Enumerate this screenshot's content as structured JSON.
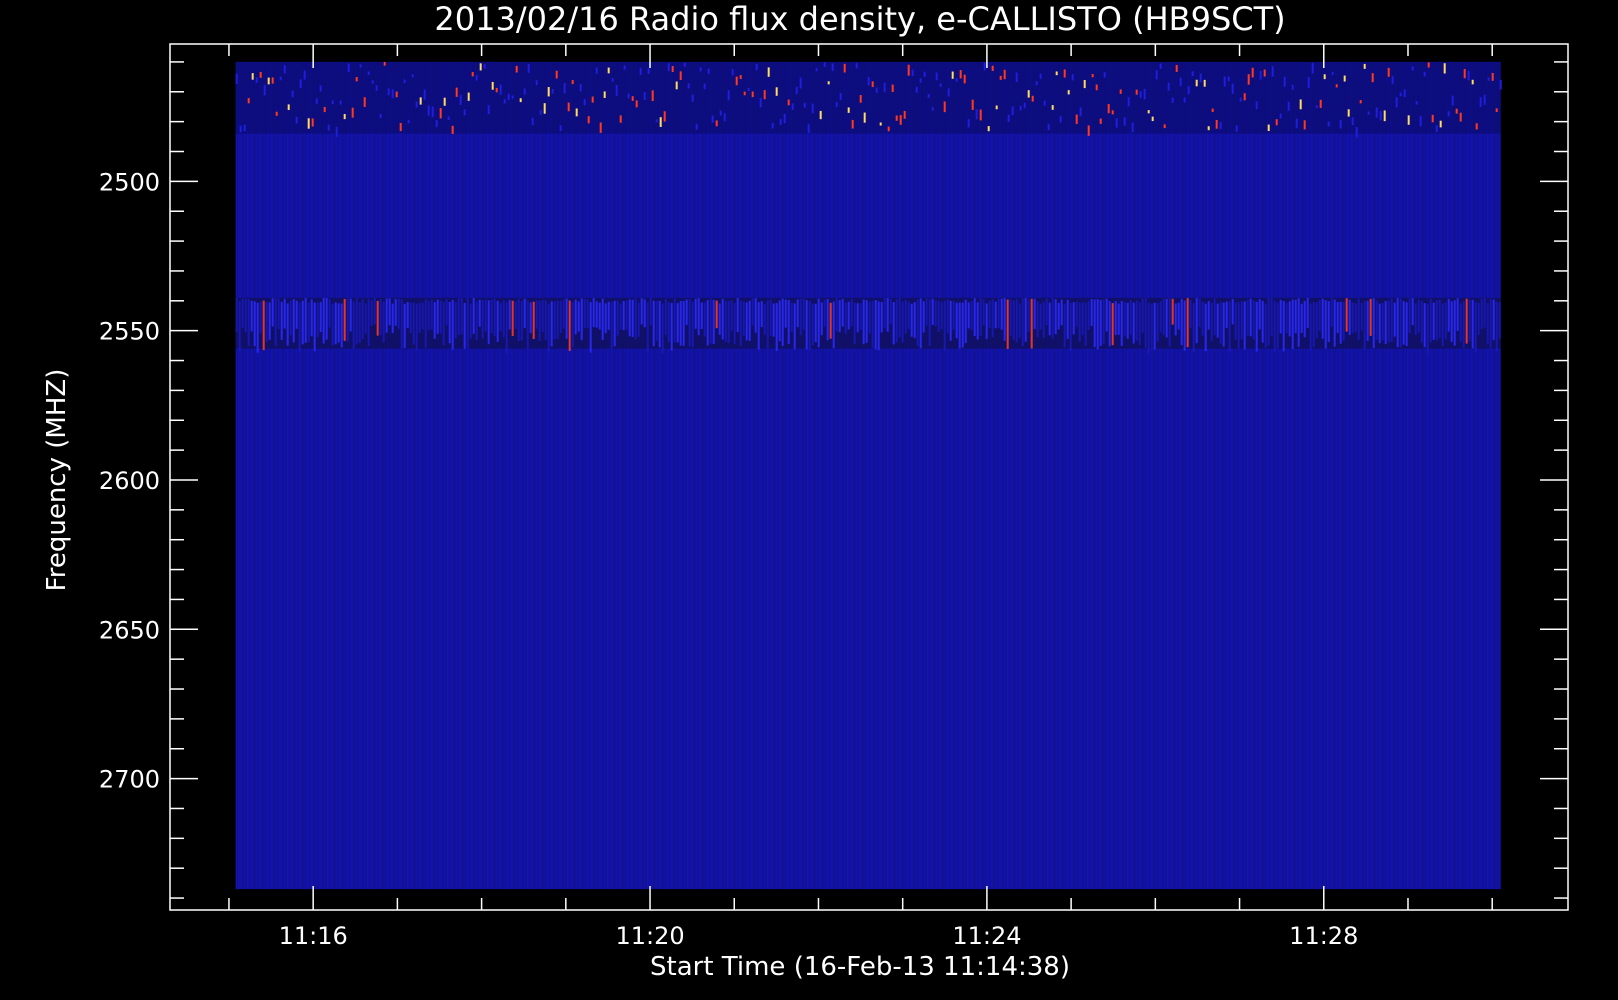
{
  "chart_data": {
    "type": "heatmap",
    "title": "2013/02/16  Radio flux density, e-CALLISTO (HB9SCT)",
    "xlabel": "Start Time (16-Feb-13 11:14:38)",
    "ylabel": "Frequency (MHZ)",
    "x_ticks": [
      "11:16",
      "11:20",
      "11:24",
      "11:28"
    ],
    "x_tick_minutes": [
      16,
      20,
      24,
      28
    ],
    "xlim_minutes": [
      14.3,
      30.9
    ],
    "data_x_minutes": [
      15.08,
      30.1
    ],
    "y_ticks": [
      2500,
      2550,
      2600,
      2650,
      2700
    ],
    "ylim": [
      2454,
      2744
    ],
    "data_y": [
      2460,
      2737
    ],
    "y_inverted": true,
    "colormap": [
      "#000000",
      "#0a0a9a",
      "#1e1edc",
      "#ff3a1e",
      "#ffdc64"
    ],
    "bands": [
      {
        "y_from": 2460,
        "y_to": 2484,
        "intensity": "bursts-bright"
      },
      {
        "y_from": 2539,
        "y_to": 2556,
        "intensity": "enhanced"
      }
    ]
  }
}
